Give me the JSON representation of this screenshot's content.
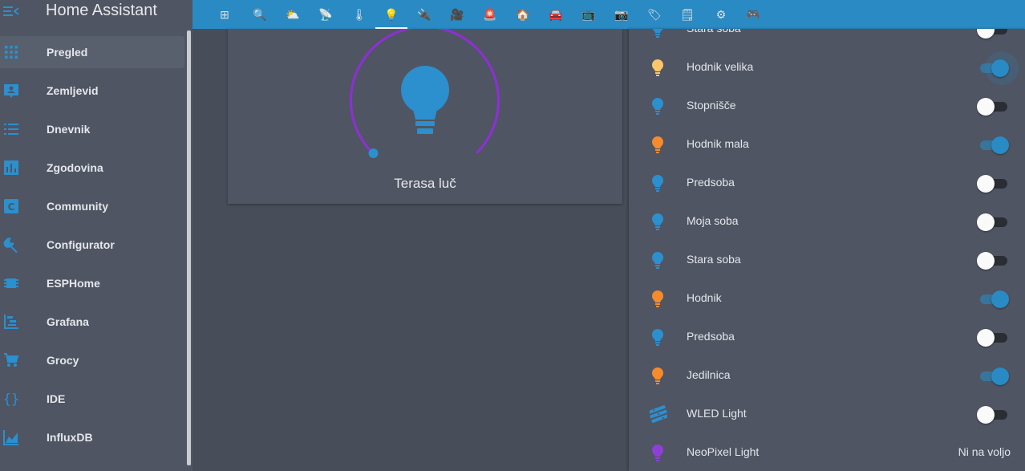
{
  "app": {
    "title": "Home Assistant"
  },
  "sidebar": {
    "items": [
      {
        "label": "Pregled",
        "icon": "grid-icon",
        "active": true
      },
      {
        "label": "Zemljevid",
        "icon": "map-account-icon"
      },
      {
        "label": "Dnevnik",
        "icon": "list-icon"
      },
      {
        "label": "Zgodovina",
        "icon": "chart-bar-icon"
      },
      {
        "label": "Community",
        "icon": "community-icon"
      },
      {
        "label": "Configurator",
        "icon": "wrench-icon"
      },
      {
        "label": "ESPHome",
        "icon": "chip-icon"
      },
      {
        "label": "Grafana",
        "icon": "chart-gantt-icon"
      },
      {
        "label": "Grocy",
        "icon": "cart-icon"
      },
      {
        "label": "IDE",
        "icon": "code-braces-icon"
      },
      {
        "label": "InfluxDB",
        "icon": "chart-area-icon"
      }
    ]
  },
  "toolbar": {
    "tabs": [
      {
        "icon": "floorplan-icon",
        "glyph": "⊞"
      },
      {
        "icon": "search-icon",
        "glyph": "🔍"
      },
      {
        "icon": "weather-icon",
        "glyph": "⛅"
      },
      {
        "icon": "satellite-icon",
        "glyph": "📡"
      },
      {
        "icon": "thermometer-icon",
        "glyph": "🌡"
      },
      {
        "icon": "lightbulb-icon",
        "glyph": "💡",
        "active": true
      },
      {
        "icon": "plug-icon",
        "glyph": "🔌"
      },
      {
        "icon": "camera-video-icon",
        "glyph": "🎥"
      },
      {
        "icon": "siren-icon",
        "glyph": "🚨"
      },
      {
        "icon": "home-icon",
        "glyph": "🏠"
      },
      {
        "icon": "car-icon",
        "glyph": "🚘"
      },
      {
        "icon": "tv-icon",
        "glyph": "📺"
      },
      {
        "icon": "camera-icon",
        "glyph": "📷"
      },
      {
        "icon": "tag-icon",
        "glyph": "🏷"
      },
      {
        "icon": "notepad-icon",
        "glyph": "🗒"
      },
      {
        "icon": "gear-icon",
        "glyph": "⚙"
      },
      {
        "icon": "gamepad-icon",
        "glyph": "🎮"
      }
    ]
  },
  "light_card": {
    "name": "Terasa luč"
  },
  "lights": [
    {
      "name": "Stara soba",
      "state": "off",
      "icon_color": "#2c8fce"
    },
    {
      "name": "Hodnik velika",
      "state": "on",
      "icon_color": "#fbc76a"
    },
    {
      "name": "Stopnišče",
      "state": "off",
      "icon_color": "#2c8fce"
    },
    {
      "name": "Hodnik mala",
      "state": "on",
      "icon_color": "#f58b2b"
    },
    {
      "name": "Predsoba",
      "state": "off",
      "icon_color": "#2c8fce"
    },
    {
      "name": "Moja soba",
      "state": "off",
      "icon_color": "#2c8fce"
    },
    {
      "name": "Stara soba",
      "state": "off",
      "icon_color": "#2c8fce"
    },
    {
      "name": "Hodnik",
      "state": "on",
      "icon_color": "#f58b2b"
    },
    {
      "name": "Predsoba",
      "state": "off",
      "icon_color": "#2c8fce"
    },
    {
      "name": "Jedilnica",
      "state": "on",
      "icon_color": "#f58b2b"
    },
    {
      "name": "WLED Light",
      "state": "off",
      "icon_color": "#2c8fce",
      "icon": "led-strip-icon"
    },
    {
      "name": "NeoPixel Light",
      "state_text": "Ni na voljo",
      "icon_color": "#8e3fd6"
    }
  ],
  "colors": {
    "accent": "#2a8ac3",
    "dial": "#8e2fd6",
    "on_bulb": "#f58b2b"
  }
}
